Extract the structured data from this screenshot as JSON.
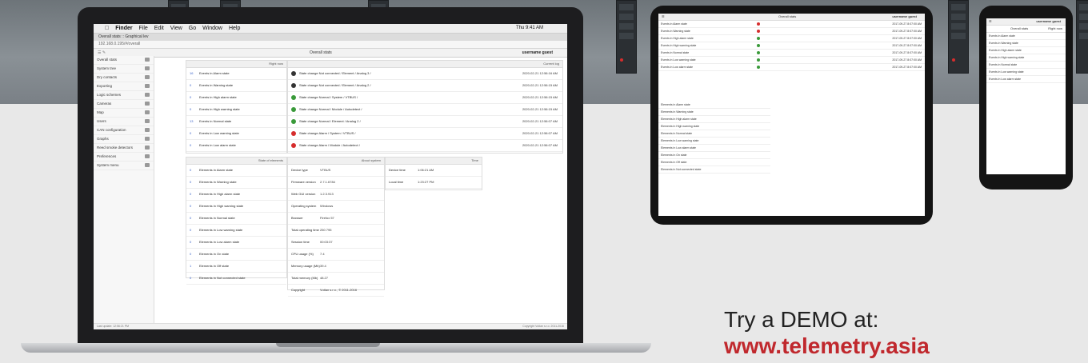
{
  "colors": {
    "accent_red": "#c0282d",
    "status_green": "#3a9a3a",
    "status_red": "#d62d2d",
    "status_dark": "#333333",
    "link_blue": "#3a63c9"
  },
  "cta": {
    "line1": "Try a DEMO at:",
    "line2": "www.telemetry.asia"
  },
  "laptop": {
    "menubar": {
      "apple": "",
      "items": [
        "Finder",
        "File",
        "Edit",
        "View",
        "Go",
        "Window",
        "Help"
      ],
      "clock": "Thu 9:41 AM"
    },
    "tab": "Overall stats :: Graphical lev",
    "address": "192.168.0.195/#/overall",
    "toolbar": {
      "title": "Overall stats",
      "user": "username guest"
    },
    "sidebar": [
      "Overall stats",
      "System tree",
      "Dry contacts",
      "Exporting",
      "Logic schemes",
      "Cameras",
      "Map",
      "Users",
      "CAN configuration",
      "Graphs",
      "Reed smoke detectors",
      "Preferences",
      "System menu"
    ],
    "events_panel": {
      "header": "Right now",
      "rows": [
        {
          "num": "16",
          "text": "Events in Alarm state"
        },
        {
          "num": "0",
          "text": "Events in Warning state"
        },
        {
          "num": "0",
          "text": "Events in High alarm state"
        },
        {
          "num": "0",
          "text": "Events in High warning state"
        },
        {
          "num": "13",
          "text": "Events in Normal state"
        },
        {
          "num": "0",
          "text": "Events in Low warning state"
        },
        {
          "num": "0",
          "text": "Events in Low alarm state"
        }
      ]
    },
    "log_panel": {
      "header": "Current log",
      "rows": [
        {
          "status": "dark",
          "text": "State change Not connected / Element / Analog 3 /",
          "ts": "2020-02-21 12:56:16 AM"
        },
        {
          "status": "dark",
          "text": "State change Not connected / Element / Analog 2 /",
          "ts": "2020-02-21 12:56:15 AM"
        },
        {
          "status": "green",
          "text": "State change Normal / System / VTBUS /",
          "ts": "2020-02-21 12:56:15 AM"
        },
        {
          "status": "green",
          "text": "State change Normal / Module / Autodetect /",
          "ts": "2020-02-21 12:56:15 AM"
        },
        {
          "status": "green",
          "text": "State change Normal / Element / Analog 2 /",
          "ts": "2020-02-21 12:56:07 AM"
        },
        {
          "status": "red",
          "text": "State change Alarm / System / VTBUS /",
          "ts": "2020-02-21 12:56:07 AM"
        },
        {
          "status": "red",
          "text": "State change Alarm / Module / Autodetect /",
          "ts": "2020-02-21 12:56:07 AM"
        }
      ]
    },
    "elements_panel": {
      "header": "State of elements",
      "rows": [
        {
          "num": "0",
          "text": "Elements in Alarm state"
        },
        {
          "num": "0",
          "text": "Elements in Warning state"
        },
        {
          "num": "0",
          "text": "Elements in High alarm state"
        },
        {
          "num": "0",
          "text": "Elements in High warning state"
        },
        {
          "num": "0",
          "text": "Elements in Normal state"
        },
        {
          "num": "0",
          "text": "Elements in Low warning state"
        },
        {
          "num": "0",
          "text": "Elements in Low alarm state"
        },
        {
          "num": "0",
          "text": "Elements in On state"
        },
        {
          "num": "1",
          "text": "Elements in Off state"
        },
        {
          "num": "0",
          "text": "Elements in Not connected state"
        }
      ]
    },
    "system_panel": {
      "header": "About system",
      "rows": [
        {
          "label": "Device type",
          "value": "VTBUS"
        },
        {
          "label": "Firmware version",
          "value": "2.7.1.6784"
        },
        {
          "label": "Web GUI version",
          "value": "1.2.3.913"
        },
        {
          "label": "Operating system",
          "value": "Windows"
        },
        {
          "label": "Browser",
          "value": "Firefox 57"
        },
        {
          "label": "Total operating time",
          "value": "250 795"
        },
        {
          "label": "Session time",
          "value": "00:03:37"
        },
        {
          "label": "CPU usage (%)",
          "value": "7.4"
        },
        {
          "label": "Memory usage (Mb)",
          "value": "39.4"
        },
        {
          "label": "Total memory (Mb)",
          "value": "48.27"
        },
        {
          "label": "Copyright",
          "value": "Vutlan s.r.o., © 2011-2016"
        }
      ]
    },
    "time_panel": {
      "header": "Time",
      "rows": [
        {
          "label": "Device time",
          "value": "1:06:21 AM"
        },
        {
          "label": "Local time",
          "value": "1:23:27 PM"
        }
      ]
    },
    "status_left": "Last update: 12:56:21 PM",
    "status_right": "Copyright Vutlan s.r.o. 2011-2016"
  },
  "tablet": {
    "title": "Overall stats",
    "user": "username guest",
    "rows": [
      {
        "status": "red",
        "text": "Events in Alarm state",
        "ts": "2017-09-27 8:07:00 AM"
      },
      {
        "status": "red",
        "text": "Events in Warning state",
        "ts": "2017-09-27 8:07:00 AM"
      },
      {
        "status": "green",
        "text": "Events in High alarm state",
        "ts": "2017-09-27 8:07:00 AM"
      },
      {
        "status": "green",
        "text": "Events in High warning state",
        "ts": "2017-09-27 8:07:00 AM"
      },
      {
        "status": "green",
        "text": "Events in Normal state",
        "ts": "2017-09-27 8:07:00 AM"
      },
      {
        "status": "green",
        "text": "Events in Low warning state",
        "ts": "2017-09-27 8:07:00 AM"
      },
      {
        "status": "green",
        "text": "Events in Low alarm state",
        "ts": "2017-09-27 8:07:00 AM"
      }
    ],
    "elements": [
      "Elements in Alarm state",
      "Elements in Warning state",
      "Elements in High alarm state",
      "Elements in High warning state",
      "Elements in Normal state",
      "Elements in Low warning state",
      "Elements in Low alarm state",
      "Elements in On state",
      "Elements in Off state",
      "Elements in Not connected state"
    ]
  },
  "phone": {
    "title": "Overall stats",
    "right": "Right now",
    "user": "username guest",
    "rows": [
      "Events in Alarm state",
      "Events in Warning state",
      "Events in High alarm state",
      "Events in High warning state",
      "Events in Normal state",
      "Events in Low warning state",
      "Events in Low alarm state"
    ]
  }
}
